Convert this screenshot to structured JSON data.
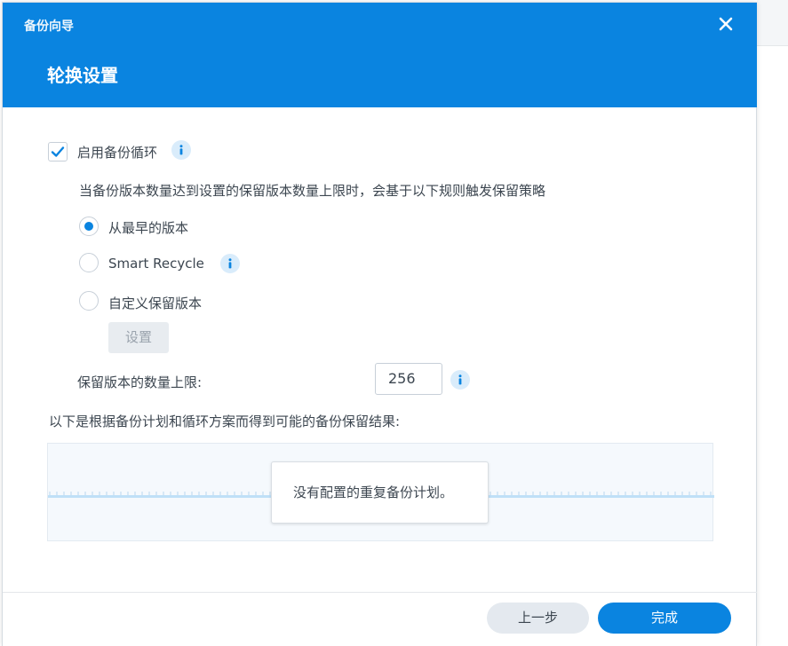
{
  "window": {
    "title": "备份向导"
  },
  "page": {
    "title": "轮换设置"
  },
  "rotation": {
    "enable_label": "启用备份循环",
    "enable_checked": true,
    "description": "当备份版本数量达到设置的保留版本数量上限时，会基于以下规则触发保留策略",
    "options": [
      {
        "label": "从最早的版本",
        "selected": true
      },
      {
        "label": "Smart Recycle",
        "selected": false
      },
      {
        "label": "自定义保留版本",
        "selected": false
      }
    ],
    "settings_button": "设置",
    "max_versions_label": "保留版本的数量上限:",
    "max_versions_value": "256"
  },
  "result": {
    "label": "以下是根据备份计划和循环方案而得到可能的备份保留结果:",
    "empty_message": "没有配置的重复备份计划。"
  },
  "footer": {
    "prev_label": "上一步",
    "done_label": "完成"
  },
  "colors": {
    "accent": "#0a84e0",
    "info_bg": "#d9ecfb"
  },
  "icons": {
    "close": "close-icon",
    "check": "check-icon",
    "info": "info-icon"
  }
}
